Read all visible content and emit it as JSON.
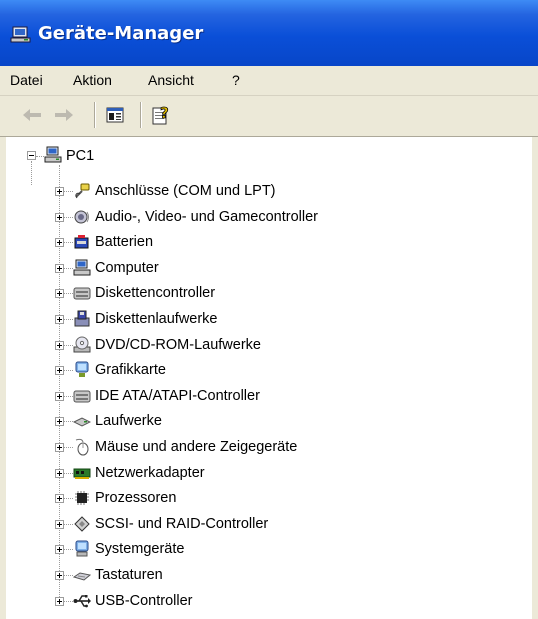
{
  "window": {
    "title": "Geräte-Manager",
    "accent": "#0a4fd8"
  },
  "menu": {
    "items": [
      "Datei",
      "Aktion",
      "Ansicht",
      "?"
    ]
  },
  "toolbar": {
    "buttons": [
      "back-arrow-icon",
      "forward-arrow-icon",
      "show-hide-console-tree-icon",
      "help-icon"
    ]
  },
  "tree": {
    "root": {
      "label": "PC1",
      "icon": "computer-icon",
      "expanded": true
    },
    "items": [
      {
        "label": "Anschlüsse (COM und LPT)",
        "icon": "port-connector-icon"
      },
      {
        "label": "Audio-, Video- und Gamecontroller",
        "icon": "speaker-icon"
      },
      {
        "label": "Batterien",
        "icon": "battery-icon"
      },
      {
        "label": "Computer",
        "icon": "computer-icon"
      },
      {
        "label": "Diskettencontroller",
        "icon": "disk-controller-icon"
      },
      {
        "label": "Diskettenlaufwerke",
        "icon": "floppy-drive-icon"
      },
      {
        "label": "DVD/CD-ROM-Laufwerke",
        "icon": "cd-drive-icon"
      },
      {
        "label": "Grafikkarte",
        "icon": "display-adapter-icon"
      },
      {
        "label": "IDE ATA/ATAPI-Controller",
        "icon": "ide-controller-icon"
      },
      {
        "label": "Laufwerke",
        "icon": "hard-drive-icon"
      },
      {
        "label": "Mäuse und andere Zeigegeräte",
        "icon": "mouse-icon"
      },
      {
        "label": "Netzwerkadapter",
        "icon": "network-adapter-icon"
      },
      {
        "label": "Prozessoren",
        "icon": "processor-icon"
      },
      {
        "label": "SCSI- und RAID-Controller",
        "icon": "scsi-controller-icon"
      },
      {
        "label": "Systemgeräte",
        "icon": "system-device-icon"
      },
      {
        "label": "Tastaturen",
        "icon": "keyboard-icon"
      },
      {
        "label": "USB-Controller",
        "icon": "usb-icon"
      }
    ]
  }
}
